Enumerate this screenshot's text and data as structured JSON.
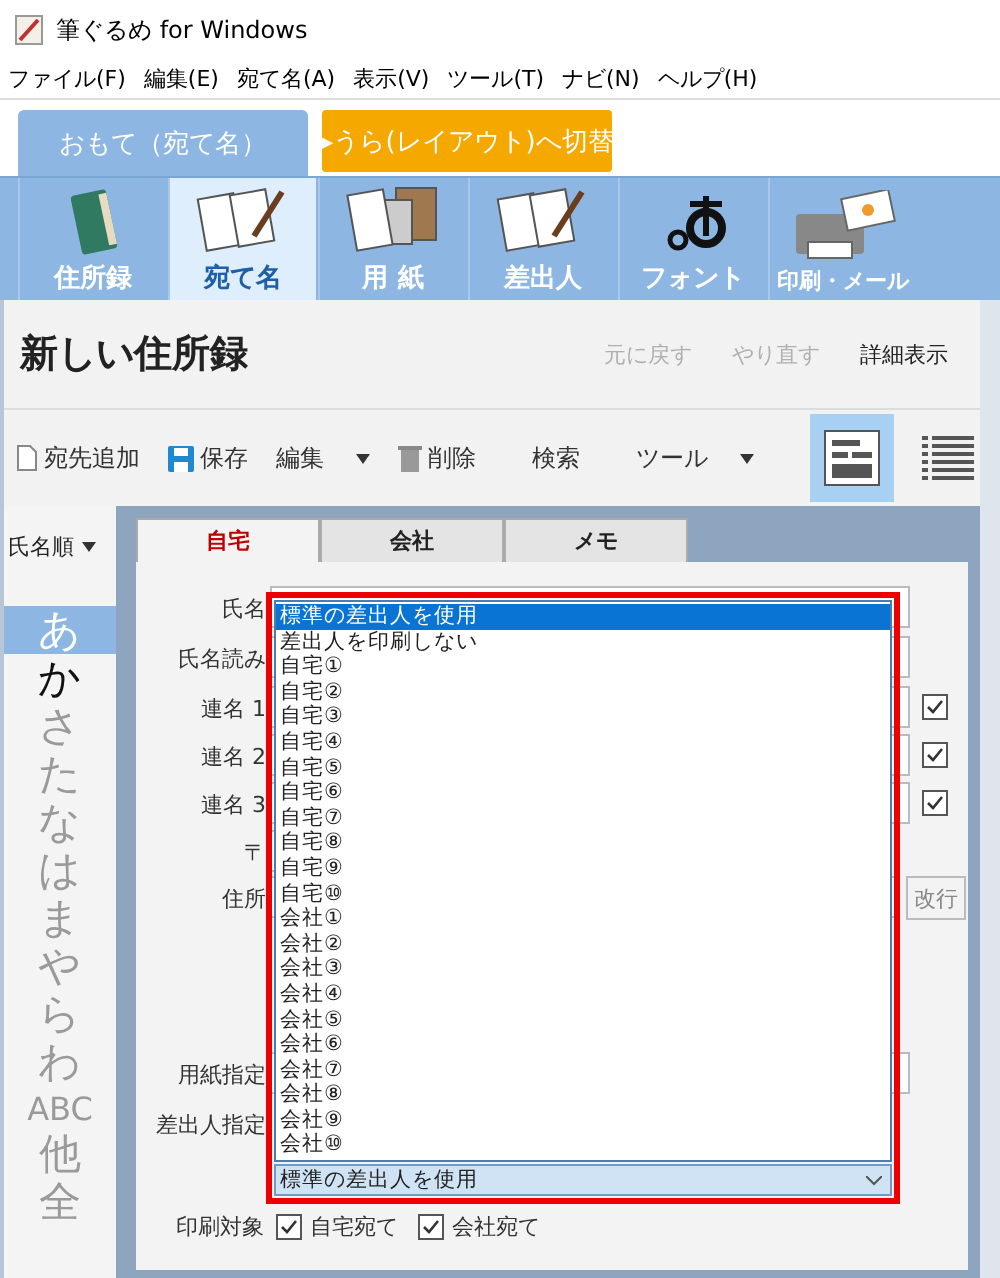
{
  "window": {
    "title": "筆ぐるめ for Windows"
  },
  "menu": [
    "ファイル(F)",
    "編集(E)",
    "宛て名(A)",
    "表示(V)",
    "ツール(T)",
    "ナビ(N)",
    "ヘルプ(H)"
  ],
  "side_tabs": [
    {
      "label": "おもて（宛て名）",
      "selected": true,
      "kind": "tab"
    },
    {
      "label": "▸うら(レイアウト)へ切替",
      "selected": false,
      "kind": "switch"
    }
  ],
  "ribbon": [
    {
      "label": "住所録",
      "selected": false
    },
    {
      "label": "宛て名",
      "selected": true
    },
    {
      "label": "用 紙",
      "selected": false
    },
    {
      "label": "差出人",
      "selected": false
    },
    {
      "label": "フォント",
      "selected": false
    },
    {
      "label": "印刷・メール",
      "selected": false
    }
  ],
  "header": {
    "title": "新しい住所録",
    "actions": [
      {
        "label": "元に戻す",
        "disabled": true
      },
      {
        "label": "やり直す",
        "disabled": true
      },
      {
        "label": "詳細表示",
        "disabled": false
      }
    ]
  },
  "toolbar": [
    {
      "label": "宛先追加",
      "kind": "icon"
    },
    {
      "label": "保存",
      "kind": "icon"
    },
    {
      "label": "編集",
      "kind": "menu"
    },
    {
      "label": "削除",
      "kind": "icon"
    },
    {
      "label": "検索",
      "kind": "nav"
    },
    {
      "label": "ツール",
      "kind": "menu"
    }
  ],
  "view_buttons": [
    {
      "selected": true
    },
    {
      "selected": false
    }
  ],
  "sort": {
    "label": "氏名順"
  },
  "kana_index": [
    {
      "label": "あ",
      "selected": true,
      "disabled": false
    },
    {
      "label": "か",
      "selected": false,
      "disabled": false
    },
    {
      "label": "さ",
      "selected": false,
      "disabled": true
    },
    {
      "label": "た",
      "selected": false,
      "disabled": true
    },
    {
      "label": "な",
      "selected": false,
      "disabled": true
    },
    {
      "label": "は",
      "selected": false,
      "disabled": true
    },
    {
      "label": "ま",
      "selected": false,
      "disabled": true
    },
    {
      "label": "や",
      "selected": false,
      "disabled": true
    },
    {
      "label": "ら",
      "selected": false,
      "disabled": true
    },
    {
      "label": "わ",
      "selected": false,
      "disabled": true
    },
    {
      "label": "ABC",
      "selected": false,
      "disabled": true
    },
    {
      "label": "他",
      "selected": false,
      "disabled": true
    },
    {
      "label": "全",
      "selected": false,
      "disabled": true
    }
  ],
  "form_tabs": [
    {
      "label": "自宅",
      "selected": true
    },
    {
      "label": "会社",
      "selected": false
    },
    {
      "label": "メモ",
      "selected": false
    }
  ],
  "fields": [
    {
      "label": "氏名",
      "kind": "text"
    },
    {
      "label": "氏名読み",
      "kind": "text"
    },
    {
      "label": "連名 1",
      "kind": "check",
      "checked": true
    },
    {
      "label": "連名 2",
      "kind": "check",
      "checked": true
    },
    {
      "label": "連名 3",
      "kind": "check",
      "checked": true
    },
    {
      "label": "〒",
      "kind": "short"
    },
    {
      "label": "住所",
      "kind": "address",
      "button": "改行"
    },
    {
      "label": "用紙指定",
      "kind": "text"
    },
    {
      "label": "差出人指定",
      "kind": "combo"
    }
  ],
  "sender_dropdown": {
    "value": "標準の差出人を使用",
    "options": [
      {
        "label": "標準の差出人を使用",
        "selected": true
      },
      {
        "label": "差出人を印刷しない",
        "selected": false
      },
      {
        "label": "自宅①",
        "selected": false
      },
      {
        "label": "自宅②",
        "selected": false
      },
      {
        "label": "自宅③",
        "selected": false
      },
      {
        "label": "自宅④",
        "selected": false
      },
      {
        "label": "自宅⑤",
        "selected": false
      },
      {
        "label": "自宅⑥",
        "selected": false
      },
      {
        "label": "自宅⑦",
        "selected": false
      },
      {
        "label": "自宅⑧",
        "selected": false
      },
      {
        "label": "自宅⑨",
        "selected": false
      },
      {
        "label": "自宅⑩",
        "selected": false
      },
      {
        "label": "会社①",
        "selected": false
      },
      {
        "label": "会社②",
        "selected": false
      },
      {
        "label": "会社③",
        "selected": false
      },
      {
        "label": "会社④",
        "selected": false
      },
      {
        "label": "会社⑤",
        "selected": false
      },
      {
        "label": "会社⑥",
        "selected": false
      },
      {
        "label": "会社⑦",
        "selected": false
      },
      {
        "label": "会社⑧",
        "selected": false
      },
      {
        "label": "会社⑨",
        "selected": false
      },
      {
        "label": "会社⑩",
        "selected": false
      }
    ]
  },
  "print_target": {
    "label": "印刷対象",
    "options": [
      {
        "label": "自宅宛て",
        "checked": true
      },
      {
        "label": "会社宛て",
        "checked": true
      }
    ]
  }
}
